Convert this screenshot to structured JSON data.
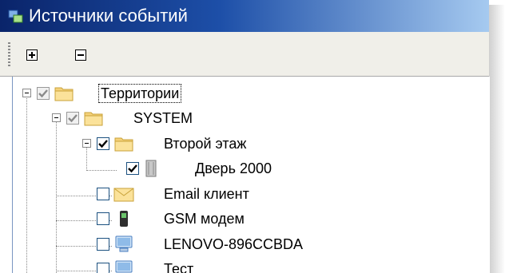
{
  "window": {
    "title": "Источники событий"
  },
  "toolbar": {
    "expand_all_symbol": "+",
    "collapse_all_symbol": "−"
  },
  "tree": {
    "root": {
      "label": "Территории",
      "checked": "partial",
      "expanded": true
    },
    "system": {
      "label": "SYSTEM",
      "checked": "partial",
      "expanded": true
    },
    "floor2": {
      "label": "Второй этаж",
      "checked": true,
      "expanded": true
    },
    "door": {
      "label": "Дверь 2000",
      "checked": true
    },
    "email": {
      "label": "Email клиент",
      "checked": false
    },
    "gsm": {
      "label": "GSM модем",
      "checked": false
    },
    "lenovo": {
      "label": "LENOVO-896CCBDA",
      "checked": false
    },
    "next": {
      "label": "Тест",
      "checked": false
    }
  },
  "colors": {
    "title_start": "#0a246a",
    "title_end": "#a6caf0",
    "folder": "#f5d27a",
    "check": "#000000"
  },
  "icons": [
    "sources-app-icon",
    "folder-icon",
    "door-icon",
    "email-icon",
    "gsm-modem-icon",
    "computer-icon"
  ]
}
